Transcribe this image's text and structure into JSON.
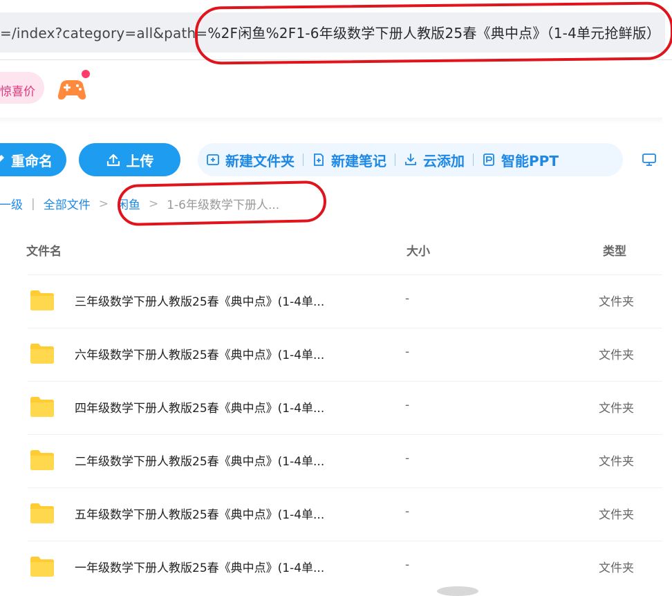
{
  "address_bar": {
    "url_prefix": "=/index?category=all&path=",
    "url_path": "%2F闲鱼%2F1-6年级数学下册人教版25春《典中点》（1-4单元抢鲜版）"
  },
  "promo": {
    "label": "惊喜价",
    "icon": "gamepad-icon"
  },
  "toolbar": {
    "rename_label": "重命名",
    "upload_label": "上传",
    "new_folder_label": "新建文件夹",
    "new_note_label": "新建笔记",
    "cloud_add_label": "云添加",
    "smart_ppt_label": "智能PPT"
  },
  "breadcrumb": {
    "back_label": "上一级",
    "items": [
      "全部文件",
      "闲鱼"
    ],
    "current": "1-6年级数学下册人..."
  },
  "table": {
    "columns": {
      "name": "文件名",
      "size": "大小",
      "type": "类型"
    },
    "rows": [
      {
        "name": "三年级数学下册人教版25春《典中点》(1-4单...",
        "size": "-",
        "type": "文件夹"
      },
      {
        "name": "六年级数学下册人教版25春《典中点》(1-4单...",
        "size": "-",
        "type": "文件夹"
      },
      {
        "name": "四年级数学下册人教版25春《典中点》(1-4单...",
        "size": "-",
        "type": "文件夹"
      },
      {
        "name": "二年级数学下册人教版25春《典中点》(1-4单...",
        "size": "-",
        "type": "文件夹"
      },
      {
        "name": "五年级数学下册人教版25春《典中点》(1-4单...",
        "size": "-",
        "type": "文件夹"
      },
      {
        "name": "一年级数学下册人教版25春《典中点》(1-4单...",
        "size": "-",
        "type": "文件夹"
      }
    ]
  },
  "colors": {
    "accent": "#1e9cf0",
    "annotation": "#e0141c",
    "folder": "#ffcc33"
  }
}
